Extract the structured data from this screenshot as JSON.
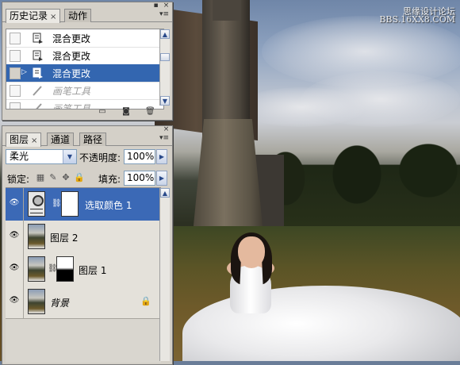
{
  "watermark": {
    "line1": "思缘设计论坛",
    "line2": "BBS.16XX8.COM"
  },
  "history_panel": {
    "tabs": [
      {
        "label": "历史记录",
        "active": true,
        "closable": true
      },
      {
        "label": "动作",
        "active": false
      }
    ],
    "rows": [
      {
        "label": "混合更改",
        "state": "normal"
      },
      {
        "label": "混合更改",
        "state": "normal"
      },
      {
        "label": "混合更改",
        "state": "selected"
      },
      {
        "label": "画笔工具",
        "state": "dimmed"
      },
      {
        "label": "画笔工具",
        "state": "dimmed"
      }
    ],
    "footer_icons": [
      "new-document-from-state-icon",
      "snapshot-icon",
      "trash-icon"
    ]
  },
  "layers_panel": {
    "tabs": [
      {
        "label": "图层",
        "active": true,
        "closable": true
      },
      {
        "label": "通道",
        "active": false
      },
      {
        "label": "路径",
        "active": false
      }
    ],
    "blend_mode": "柔光",
    "opacity_label": "不透明度:",
    "opacity_value": "100%",
    "lock_label": "锁定:",
    "fill_label": "填充:",
    "fill_value": "100%",
    "layers": [
      {
        "name": "选取颜色 1",
        "type": "adjustment",
        "selected": true,
        "visible": true
      },
      {
        "name": "图层 2",
        "type": "photo",
        "selected": false,
        "visible": true
      },
      {
        "name": "图层 1",
        "type": "photo-mask",
        "selected": false,
        "visible": true
      },
      {
        "name": "背景",
        "type": "background",
        "selected": false,
        "visible": true,
        "locked": true
      }
    ]
  },
  "colors": {
    "selection": "#3366b0",
    "panel": "#d4d0c8"
  }
}
